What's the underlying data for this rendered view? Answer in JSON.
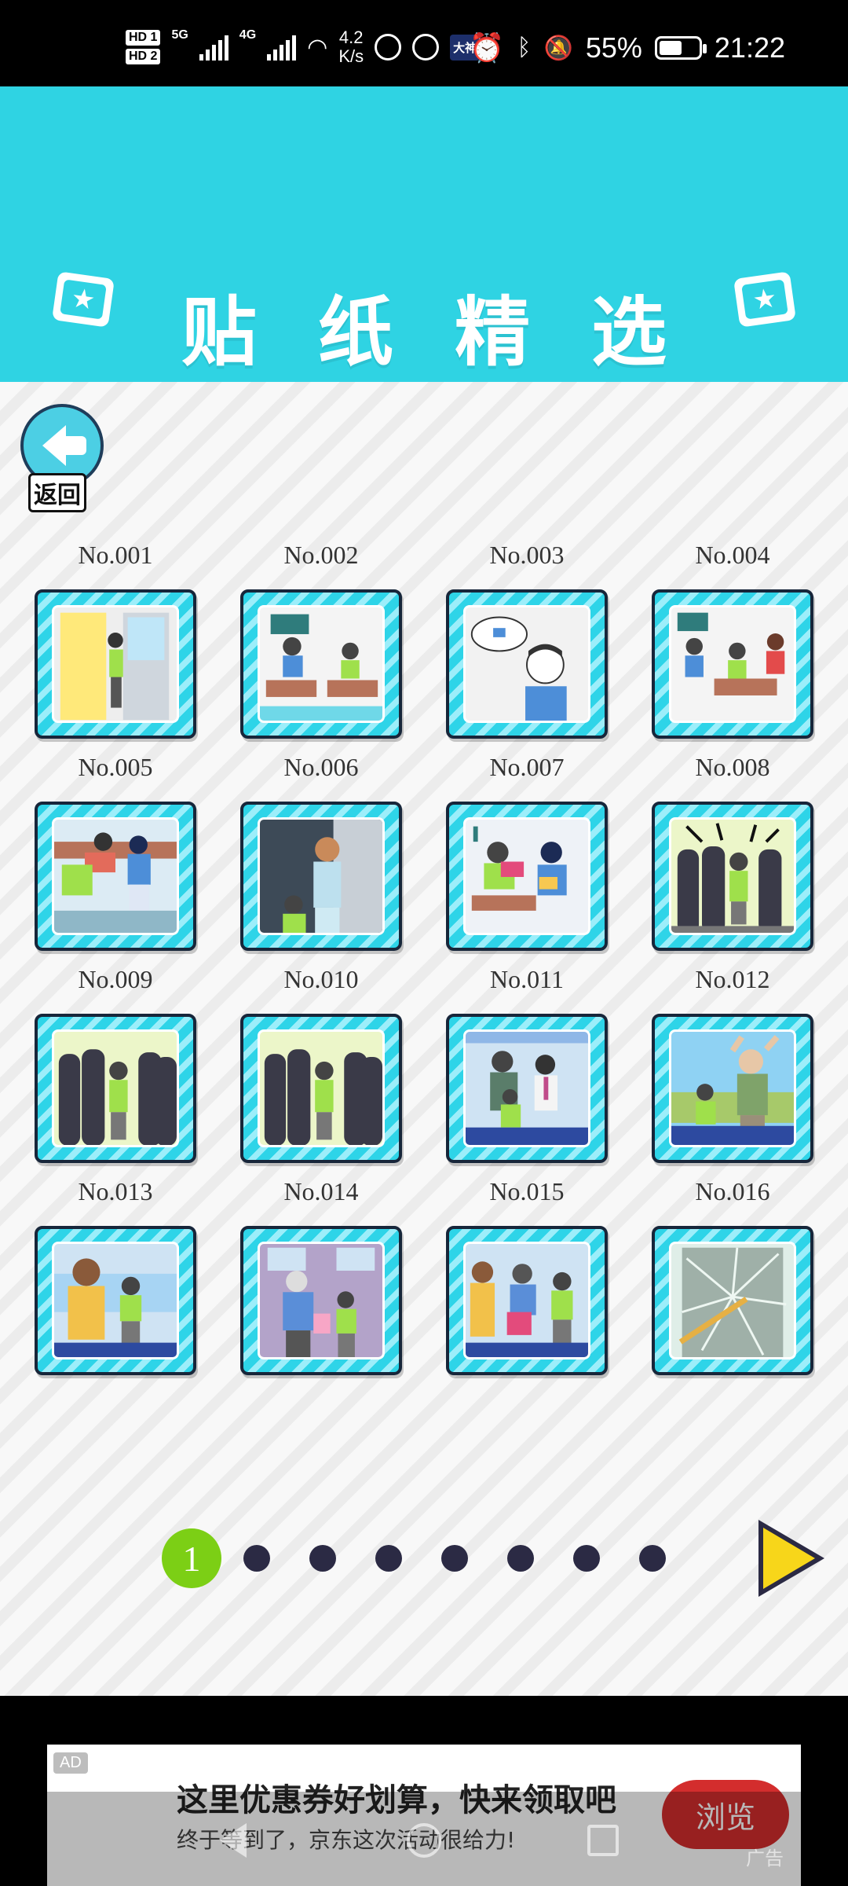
{
  "status_bar": {
    "hd1": "HD 1",
    "hd2": "HD 2",
    "net1": "5G",
    "net2": "4G",
    "speed_value": "4.2",
    "speed_unit": "K/s",
    "dashen": "大神",
    "battery_percent": "55%",
    "battery_level": 0.55,
    "time": "21:22"
  },
  "banner": {
    "title": "贴纸精选",
    "badge_icon": "star-card-icon"
  },
  "back_button": {
    "label": "返回",
    "icon": "arrow-left-icon"
  },
  "stickers": [
    {
      "label": "No.001",
      "scene": "door"
    },
    {
      "label": "No.002",
      "scene": "classroom-two"
    },
    {
      "label": "No.003",
      "scene": "thinking"
    },
    {
      "label": "No.004",
      "scene": "classroom-three"
    },
    {
      "label": "No.005",
      "scene": "desk-chase"
    },
    {
      "label": "No.006",
      "scene": "mother"
    },
    {
      "label": "No.007",
      "scene": "reading"
    },
    {
      "label": "No.008",
      "scene": "shadows-angry"
    },
    {
      "label": "No.009",
      "scene": "shadows"
    },
    {
      "label": "No.010",
      "scene": "shadows"
    },
    {
      "label": "No.011",
      "scene": "train"
    },
    {
      "label": "No.012",
      "scene": "old-man"
    },
    {
      "label": "No.013",
      "scene": "train-lady"
    },
    {
      "label": "No.014",
      "scene": "train-grandpa"
    },
    {
      "label": "No.015",
      "scene": "train-crowd"
    },
    {
      "label": "No.016",
      "scene": "broken-glass"
    }
  ],
  "pager": {
    "current": "1",
    "total_pages": 8,
    "next_icon": "next-triangle-icon"
  },
  "ad": {
    "tag": "AD",
    "title": "这里优惠券好划算，快来领取吧",
    "subtitle": "终于等到了，京东这次活动很给力!",
    "button": "浏览",
    "mark": "广告"
  },
  "colors": {
    "banner": "#2fd3e3",
    "page_active": "#7ccf15",
    "page_dot": "#2b2a44",
    "next_arrow": "#f7d61a",
    "ad_button": "#d32d2d"
  }
}
